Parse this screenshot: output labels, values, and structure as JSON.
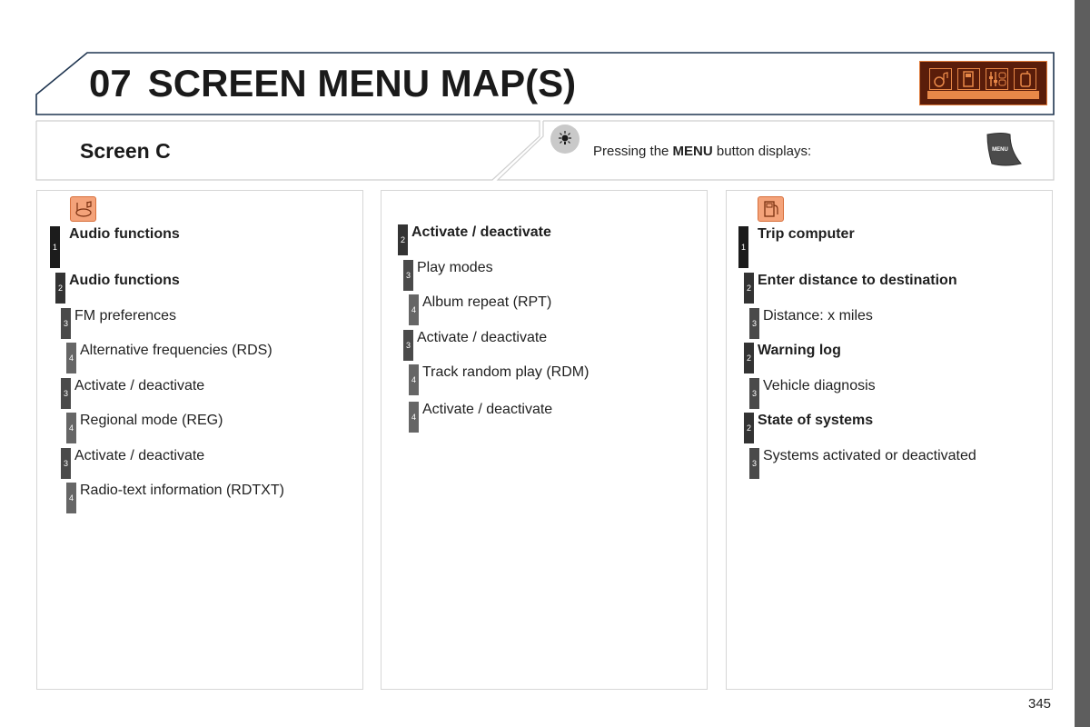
{
  "header": {
    "chapter_number": "07",
    "chapter_title": "SCREEN MENU MAP(S)",
    "badge_icons": [
      "audio-icon",
      "trip-computer-icon",
      "settings-icon",
      "phone-icon"
    ]
  },
  "banner": {
    "screen_title": "Screen C",
    "hint_prefix": "Pressing the ",
    "hint_bold": "MENU",
    "hint_suffix": " button displays:",
    "menu_key_label": "MENU",
    "hint_icon": "lightbulb-icon"
  },
  "columns": [
    {
      "icon": "audio-functions-icon",
      "items": [
        {
          "level": "1",
          "label": "Audio functions",
          "bold": true
        },
        {
          "level": "2",
          "label": "Audio functions",
          "bold": true
        },
        {
          "level": "3",
          "label": "FM preferences",
          "bold": false
        },
        {
          "level": "4",
          "label": "Alternative frequencies (RDS)",
          "bold": false
        },
        {
          "level": "3",
          "label": "Activate / deactivate",
          "bold": false
        },
        {
          "level": "4",
          "label": "Regional mode (REG)",
          "bold": false
        },
        {
          "level": "3",
          "label": "Activate / deactivate",
          "bold": false
        },
        {
          "level": "4",
          "label": "Radio-text information (RDTXT)",
          "bold": false
        }
      ]
    },
    {
      "icon": null,
      "items": [
        {
          "level": "2",
          "label": "Activate / deactivate",
          "bold": true
        },
        {
          "level": "3",
          "label": "Play modes",
          "bold": false
        },
        {
          "level": "4",
          "label": "Album repeat (RPT)",
          "bold": false
        },
        {
          "level": "3",
          "label": "Activate / deactivate",
          "bold": false
        },
        {
          "level": "4",
          "label": "Track random play (RDM)",
          "bold": false
        },
        {
          "level": "4",
          "label": "Activate / deactivate",
          "bold": false
        }
      ]
    },
    {
      "icon": "trip-computer-icon",
      "items": [
        {
          "level": "1",
          "label": "Trip computer",
          "bold": true
        },
        {
          "level": "2",
          "label": "Enter distance to destination",
          "bold": true
        },
        {
          "level": "3",
          "label": "Distance: x miles",
          "bold": false
        },
        {
          "level": "2",
          "label": "Warning log",
          "bold": true
        },
        {
          "level": "3",
          "label": "Vehicle diagnosis",
          "bold": false
        },
        {
          "level": "2",
          "label": "State of systems",
          "bold": true
        },
        {
          "level": "3",
          "label": "Systems activated or deactivated",
          "bold": false
        }
      ]
    }
  ],
  "footer": {
    "page_number": "345"
  },
  "colors": {
    "accent_orange": "#e88848",
    "badge_dark": "#5a1d0a",
    "frame_navy": "#1f3550"
  }
}
